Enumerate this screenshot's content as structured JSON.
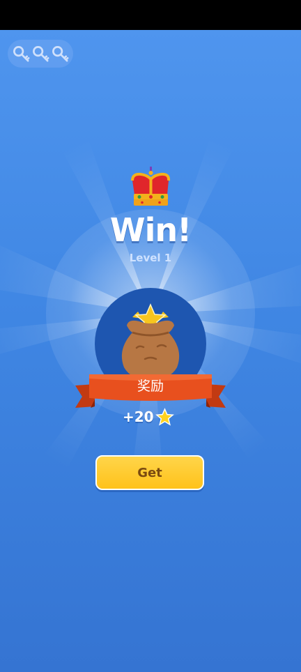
{
  "header": {
    "keys": [
      {
        "icon": "key-icon"
      },
      {
        "icon": "key-icon"
      },
      {
        "icon": "key-icon"
      }
    ]
  },
  "result": {
    "title": "Win!",
    "level_label": "Level 1",
    "crown_icon": "crown-icon"
  },
  "reward": {
    "bag_icon": "treasure-bag-icon",
    "ribbon_label": "奖励",
    "amount": "+20",
    "currency_icon": "star-icon"
  },
  "actions": {
    "get_label": "Get"
  },
  "colors": {
    "background": "#4f95ee",
    "circle": "#1e56b0",
    "ribbon": "#e8501e",
    "button": "#ffc21a",
    "button_text": "#7a4a10"
  }
}
